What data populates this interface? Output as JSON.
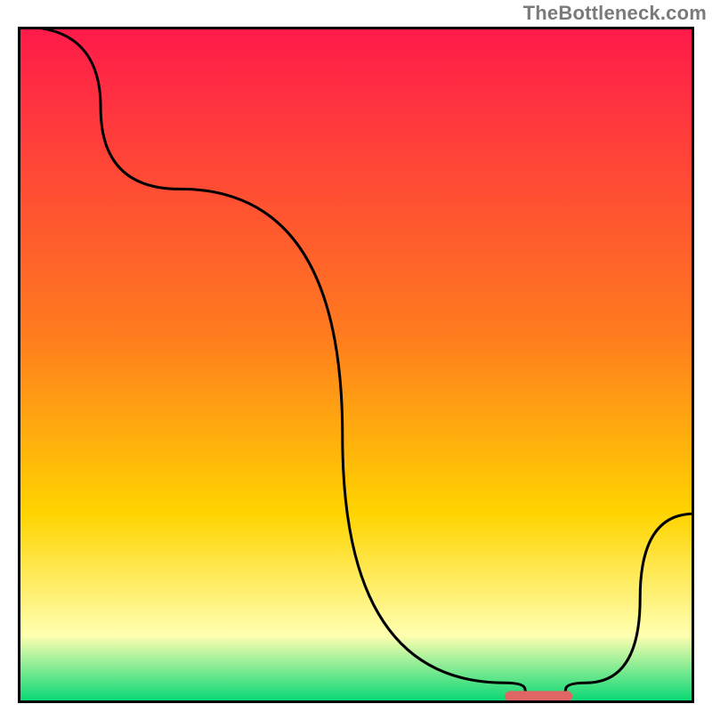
{
  "attribution": "TheBottleneck.com",
  "colors": {
    "gradient_top": "#ff1a4b",
    "gradient_mid1": "#ff7a1f",
    "gradient_mid2": "#ffd400",
    "gradient_pale": "#ffffb0",
    "gradient_green": "#00d673",
    "curve": "#000000",
    "marker": "#e06666",
    "frame": "#000000"
  },
  "chart_data": {
    "type": "line",
    "title": "",
    "xlabel": "",
    "ylabel": "",
    "xlim": [
      0,
      100
    ],
    "ylim": [
      0,
      100
    ],
    "x": [
      0.5,
      24,
      72,
      78,
      84,
      100
    ],
    "values": [
      100,
      76,
      3,
      1,
      3,
      28
    ],
    "marker": {
      "x_start": 72,
      "x_end": 82,
      "y": 1
    },
    "annotations": [],
    "legend": []
  }
}
